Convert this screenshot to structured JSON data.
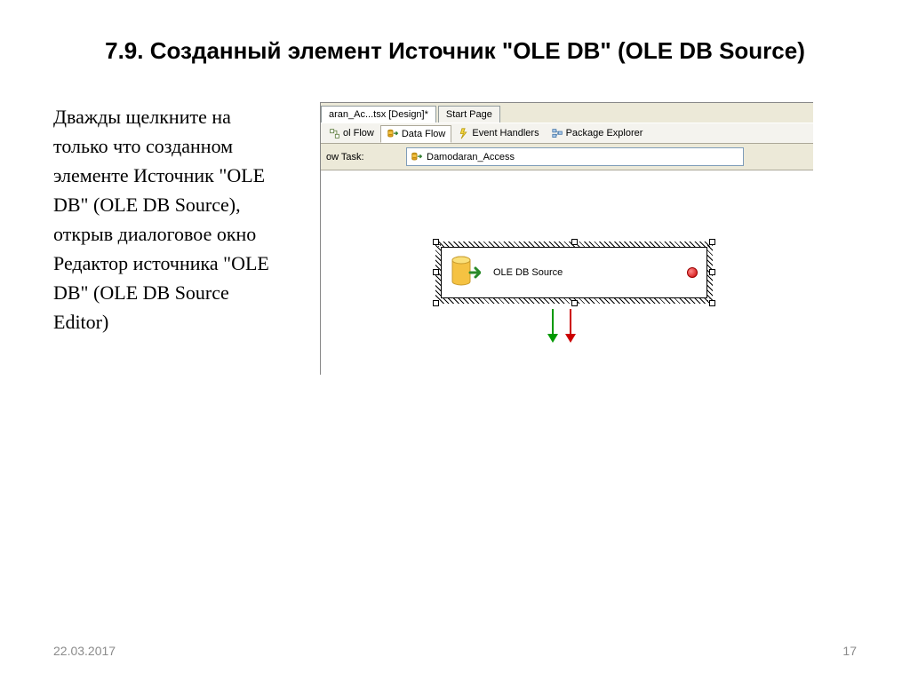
{
  "title": "7.9. Созданный элемент Источник \"OLE DB\" (OLE DB Source)",
  "body_text": "Дважды щелкните на только что созданном элементе Источник \"OLE DB\" (OLE DB Source), открыв диалоговое окно Редактор источника \"OLE DB\" (OLE DB Source Editor)",
  "vs": {
    "file_tabs": [
      {
        "label": "aran_Ac...tsx [Design]*",
        "active": true
      },
      {
        "label": "Start Page",
        "active": false
      }
    ],
    "inner_tabs": [
      {
        "label": "ol Flow",
        "active": false
      },
      {
        "label": "Data Flow",
        "active": true
      },
      {
        "label": "Event Handlers",
        "active": false
      },
      {
        "label": "Package Explorer",
        "active": false
      }
    ],
    "task_label": "ow Task:",
    "task_value": "Damodaran_Access",
    "component_label": "OLE DB Source"
  },
  "footer": {
    "date": "22.03.2017",
    "page": "17"
  }
}
